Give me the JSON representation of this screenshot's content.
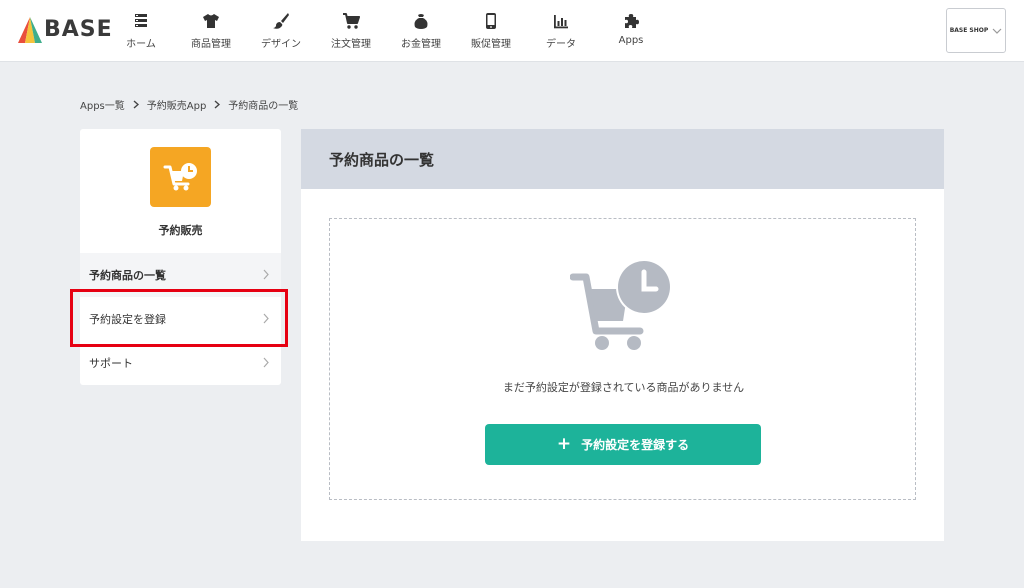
{
  "header": {
    "logo_text": "BASE",
    "nav": [
      {
        "label": "ホーム",
        "icon": "home-icon"
      },
      {
        "label": "商品管理",
        "icon": "tshirt-icon"
      },
      {
        "label": "デザイン",
        "icon": "brush-icon"
      },
      {
        "label": "注文管理",
        "icon": "cart-icon"
      },
      {
        "label": "お金管理",
        "icon": "money-bag-icon"
      },
      {
        "label": "販促管理",
        "icon": "smartphone-icon"
      },
      {
        "label": "データ",
        "icon": "bar-chart-icon"
      },
      {
        "label": "Apps",
        "icon": "puzzle-icon"
      }
    ],
    "shop_label": "BASE SHOP"
  },
  "breadcrumb": [
    "Apps一覧",
    "予約販売App",
    "予約商品の一覧"
  ],
  "sidebar": {
    "app_name": "予約販売",
    "items": [
      {
        "label": "予約商品の一覧",
        "active": true
      },
      {
        "label": "予約設定を登録",
        "active": false
      },
      {
        "label": "サポート",
        "active": false
      }
    ]
  },
  "main": {
    "title": "予約商品の一覧",
    "empty_message": "まだ予約設定が登録されている商品がありません",
    "cta_label": "予約設定を登録する"
  },
  "colors": {
    "accent": "#1db39a",
    "app_icon": "#f5a623",
    "highlight": "#e60012",
    "header_band": "#d4d9e2"
  }
}
